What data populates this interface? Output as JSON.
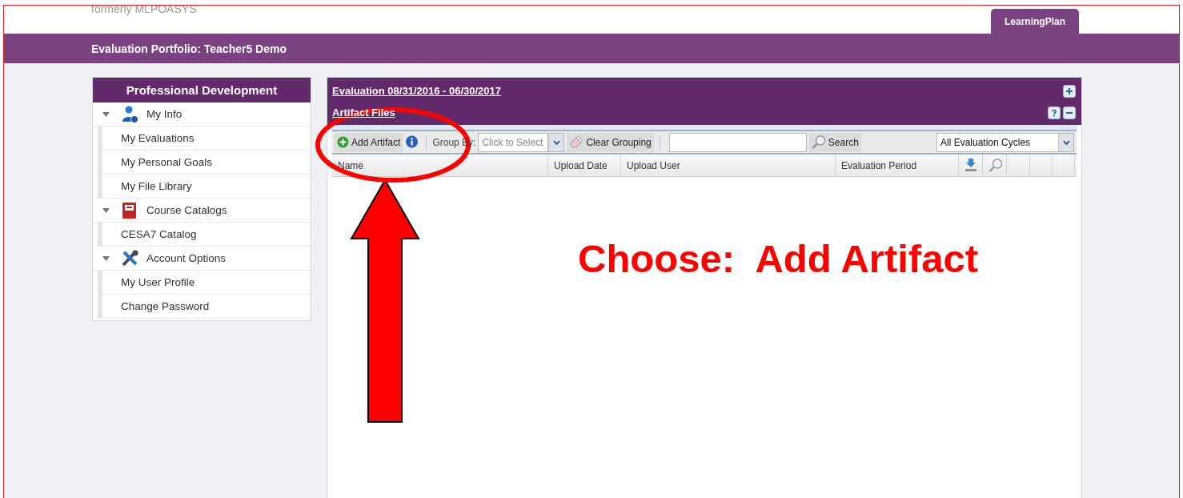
{
  "header": {
    "brand_subtitle": "formerly MLPOASYS",
    "tabs": [
      {
        "label": "LearningPlan",
        "selected": true
      }
    ]
  },
  "title_bar": {
    "title": "Evaluation Portfolio: Teacher5 Demo"
  },
  "sidebar": {
    "title": "Professional Development",
    "items": [
      {
        "label": "My Info",
        "kind": "person",
        "expanded": true,
        "children": [
          {
            "label": "My Evaluations"
          },
          {
            "label": "My Personal Goals"
          },
          {
            "label": "My File Library"
          }
        ]
      },
      {
        "label": "Course Catalogs",
        "kind": "book",
        "expanded": true,
        "children": [
          {
            "label": "CESA7 Catalog"
          }
        ]
      },
      {
        "label": "Account Options",
        "kind": "tools",
        "expanded": true,
        "children": [
          {
            "label": "My User Profile"
          },
          {
            "label": "Change Password"
          }
        ]
      }
    ]
  },
  "panel": {
    "evaluation_link": "Evaluation 08/31/2016 - 06/30/2017",
    "section_title": "Artifact Files",
    "toolbar": {
      "add_button": "Add Artifact",
      "group_by_label": "Group By:",
      "group_by_placeholder": "Click to Select",
      "clear_button": "Clear Grouping",
      "search_button": "Search",
      "cycle_select": "All Evaluation Cycles"
    },
    "columns": [
      {
        "label": "Name",
        "kind": "text"
      },
      {
        "label": "Upload Date",
        "kind": "text"
      },
      {
        "label": "Upload User",
        "kind": "text"
      },
      {
        "label": "Evaluation Period",
        "kind": "text"
      },
      {
        "kind": "download"
      },
      {
        "kind": "zoom"
      },
      {
        "kind": "empty"
      },
      {
        "kind": "empty"
      },
      {
        "kind": "empty"
      }
    ]
  },
  "annotation": {
    "caption": "Choose:  Add Artifact"
  }
}
